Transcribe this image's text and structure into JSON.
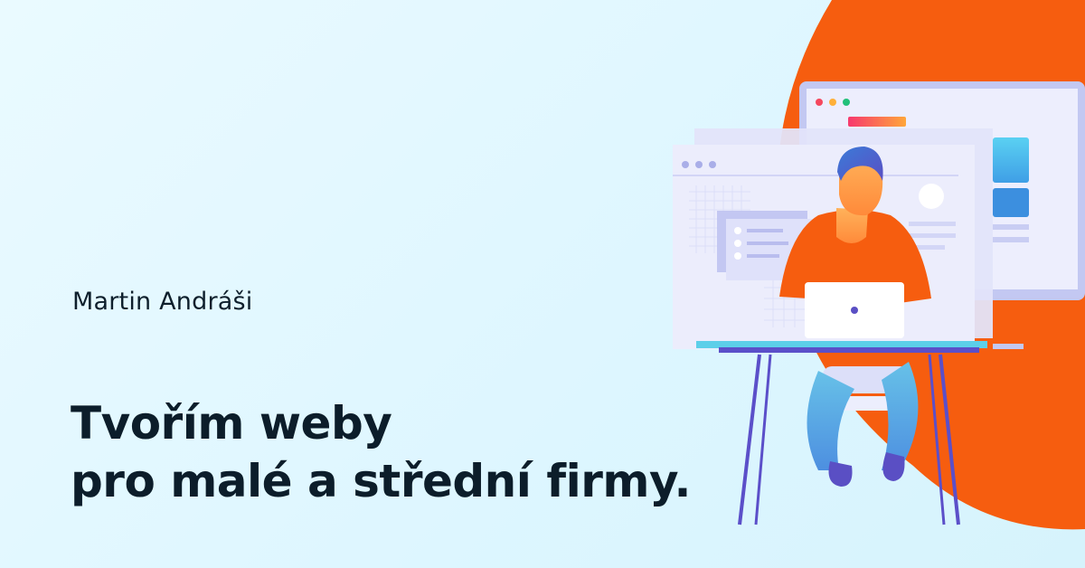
{
  "author": "Martin Andráši",
  "headline": {
    "line1": "Tvořím weby",
    "line2": "pro malé a střední firmy."
  },
  "colors": {
    "background": "#dff6ff",
    "accent_orange": "#f65d0f",
    "text_dark": "#0c1d2a",
    "desk_purple": "#5b4fc9"
  },
  "illustration": "person-at-laptop-with-browser-windows"
}
